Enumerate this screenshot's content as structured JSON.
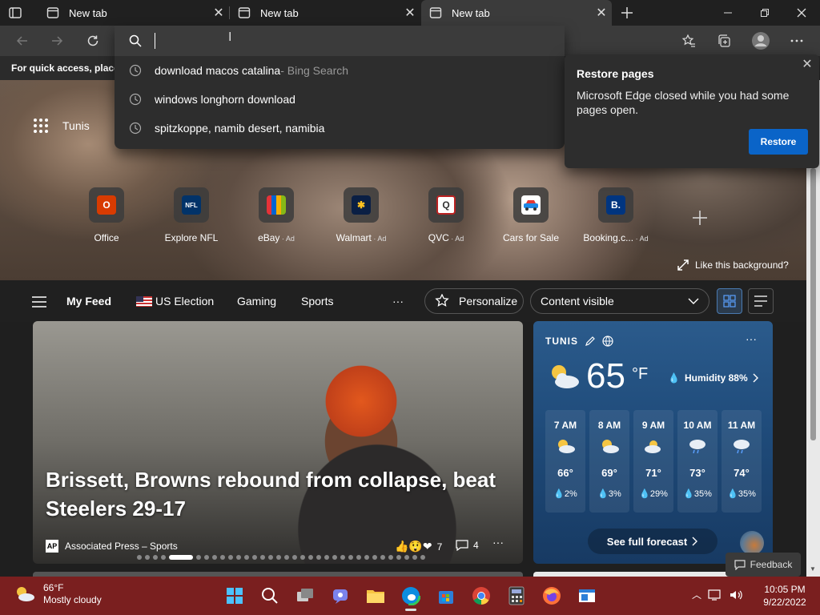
{
  "browser": {
    "tabs": [
      {
        "label": "New tab",
        "active": false
      },
      {
        "label": "New tab",
        "active": false
      },
      {
        "label": "New tab",
        "active": true
      }
    ],
    "favorites_bar_text": "For quick access, place y"
  },
  "omnibox": {
    "value": "",
    "suggestions": [
      {
        "text": "download macos catalina",
        "suffix": " - Bing Search"
      },
      {
        "text": "windows longhorn download",
        "suffix": ""
      },
      {
        "text": "spitzkoppe, namib desert, namibia",
        "suffix": ""
      }
    ]
  },
  "restore_popup": {
    "title": "Restore pages",
    "body": "Microsoft Edge closed while you had some pages open.",
    "button": "Restore"
  },
  "newtab": {
    "location": "Tunis",
    "tiles": [
      {
        "label": "Office",
        "ad": "",
        "color": "#d83b01",
        "glyph": "O"
      },
      {
        "label": "Explore NFL",
        "ad": "",
        "color": "#013369",
        "glyph": "NFL"
      },
      {
        "label": "eBay",
        "ad": " · Ad",
        "color": "#e53238",
        "glyph": "e"
      },
      {
        "label": "Walmart",
        "ad": " · Ad",
        "color": "#0071ce",
        "glyph": "✱"
      },
      {
        "label": "QVC",
        "ad": " · Ad",
        "color": "#ffffff",
        "glyph": "Q"
      },
      {
        "label": "Cars for Sale",
        "ad": "",
        "color": "#e8f0ff",
        "glyph": "🚗"
      },
      {
        "label": "Booking.c...",
        "ad": " · Ad",
        "color": "#003580",
        "glyph": "B."
      }
    ],
    "like_background": "Like this background?"
  },
  "feed_nav": {
    "my_feed": "My Feed",
    "items": [
      "US Election",
      "Gaming",
      "Sports"
    ],
    "more": "···",
    "personalize": "Personalize",
    "content_visible": "Content visible"
  },
  "news": {
    "headline": "Brissett, Browns rebound from collapse, beat Steelers 29-17",
    "source": "Associated Press – Sports",
    "reactions": "7",
    "comments": "4",
    "dot_count": 34,
    "active_dot": 4
  },
  "weather": {
    "city": "TUNIS",
    "temp": "65",
    "unit": "°F",
    "humidity": "Humidity 88%",
    "hours": [
      {
        "time": "7 AM",
        "temp": "66°",
        "precip": "2%"
      },
      {
        "time": "8 AM",
        "temp": "69°",
        "precip": "3%"
      },
      {
        "time": "9 AM",
        "temp": "71°",
        "precip": "29%"
      },
      {
        "time": "10 AM",
        "temp": "73°",
        "precip": "35%"
      },
      {
        "time": "11 AM",
        "temp": "74°",
        "precip": "35%"
      }
    ],
    "forecast_button": "See full forecast"
  },
  "feedback": "Feedback",
  "taskbar": {
    "weather_temp": "66°F",
    "weather_desc": "Mostly cloudy",
    "time": "10:05 PM",
    "date": "9/22/2022"
  }
}
